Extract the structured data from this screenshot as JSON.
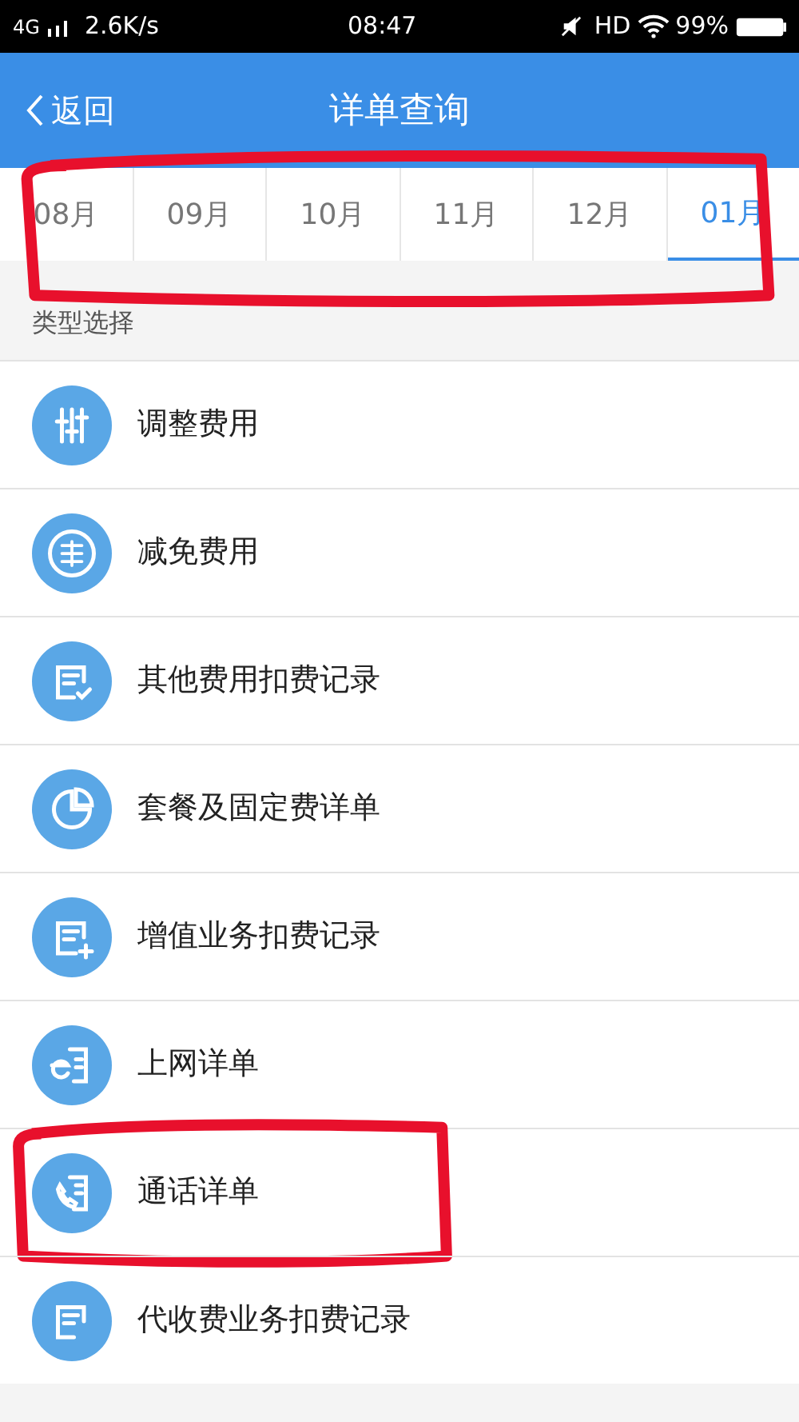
{
  "status_bar": {
    "network": "4G",
    "speed": "2.6K/s",
    "time": "08:47",
    "hd": "HD",
    "battery": "99%"
  },
  "header": {
    "back": "返回",
    "title": "详单查询"
  },
  "month_tabs": [
    {
      "label": "08月",
      "selected": false
    },
    {
      "label": "09月",
      "selected": false
    },
    {
      "label": "10月",
      "selected": false
    },
    {
      "label": "11月",
      "selected": false
    },
    {
      "label": "12月",
      "selected": false
    },
    {
      "label": "01月",
      "selected": true
    }
  ],
  "section_label": "类型选择",
  "types": [
    {
      "label": "调整费用",
      "highlighted": false
    },
    {
      "label": "减免费用",
      "highlighted": false
    },
    {
      "label": "其他费用扣费记录",
      "highlighted": false
    },
    {
      "label": "套餐及固定费详单",
      "highlighted": false
    },
    {
      "label": "增值业务扣费记录",
      "highlighted": false
    },
    {
      "label": "上网详单",
      "highlighted": false
    },
    {
      "label": "通话详单",
      "highlighted": true
    },
    {
      "label": "代收费业务扣费记录",
      "highlighted": false
    }
  ],
  "tabs_highlighted": true
}
